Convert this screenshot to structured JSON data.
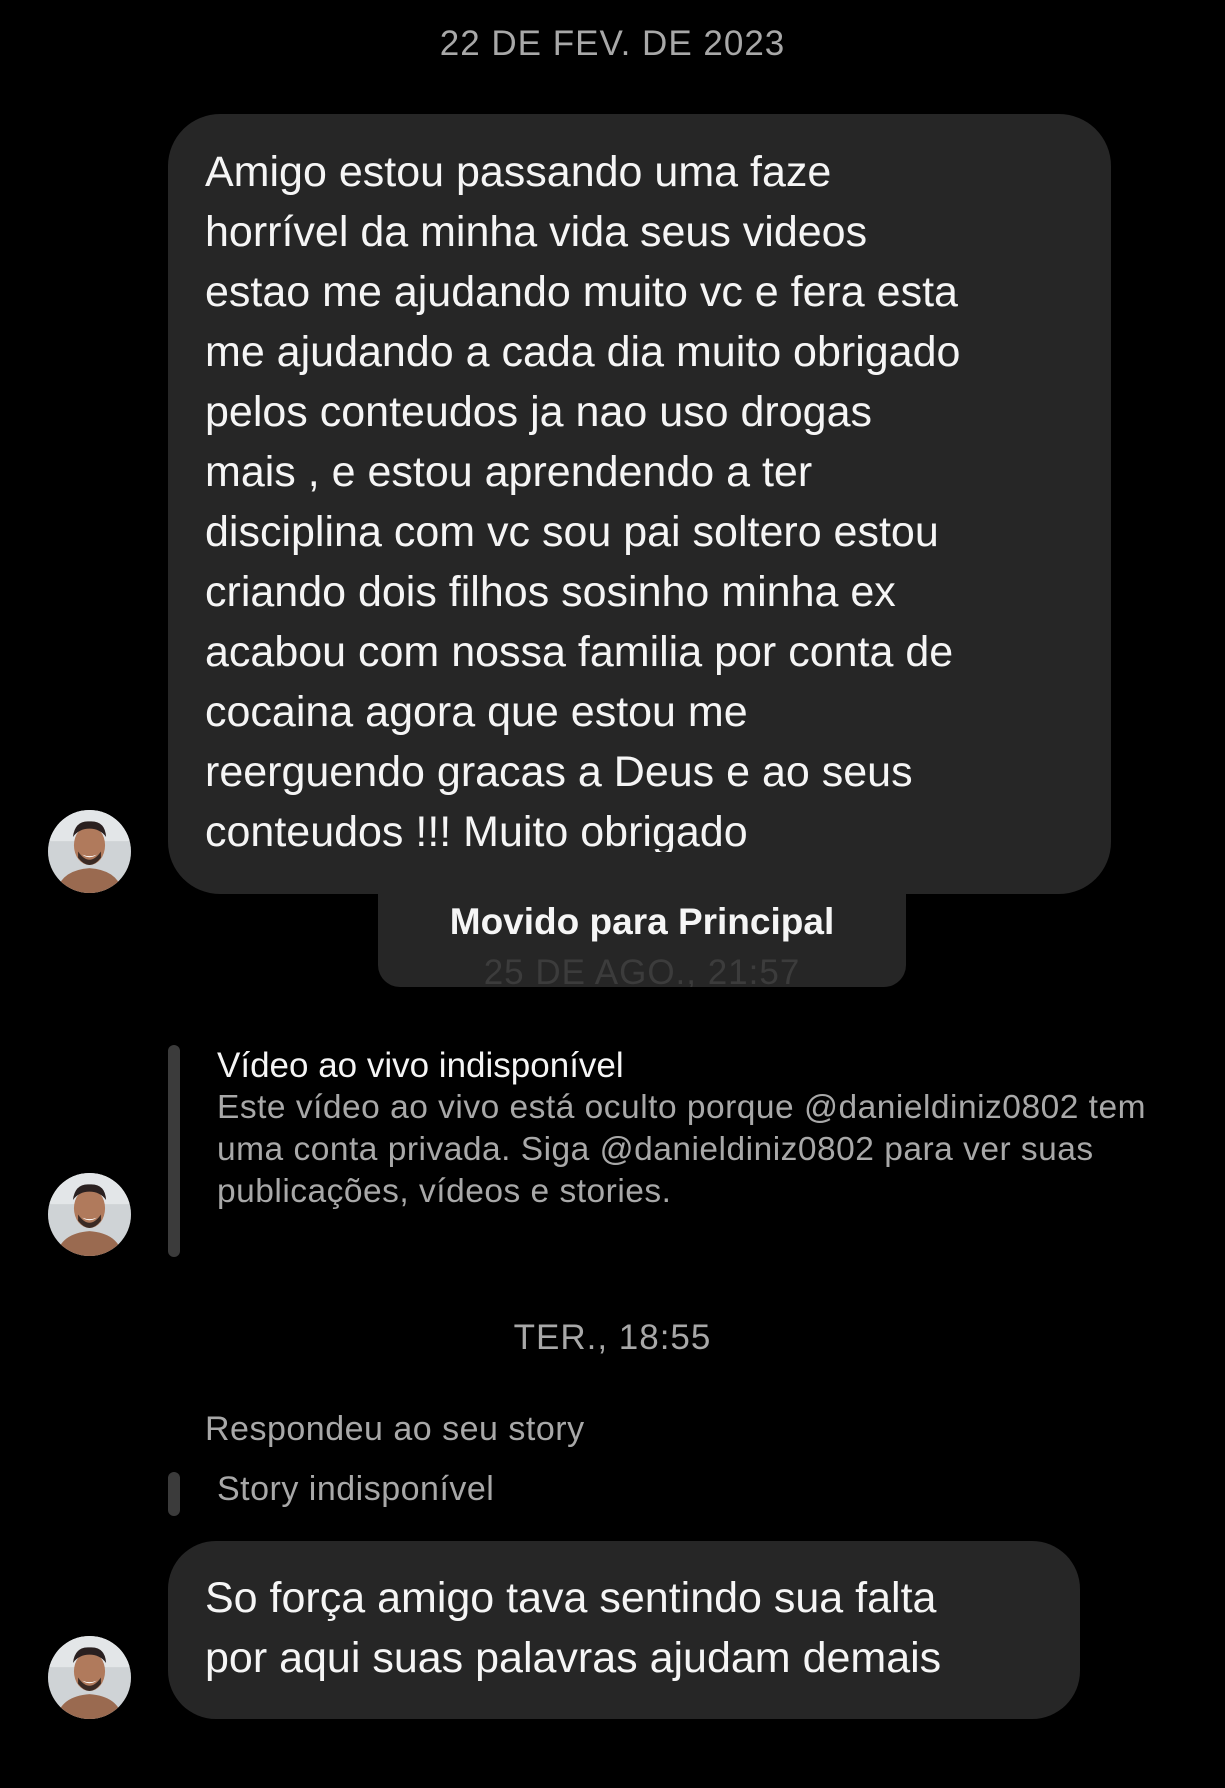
{
  "dates": {
    "first": "22 DE FEV. DE 2023",
    "third": "TER., 18:55"
  },
  "messages": [
    {
      "text": "Amigo estou passando uma faze\nhorrível da minha vida seus videos\nestao me ajudando muito vc e fera esta\nme ajudando a cada dia muito obrigado\npelos conteudos ja nao uso drogas\nmais , e estou aprendendo a ter\ndisciplina com vc sou pai soltero estou\ncriando dois filhos sosinho minha ex\nacabou com nossa familia por conta de\ncocaina agora que estou me\nreerguendo gracas a Deus e ao seus\nconteudos !!! Muito obrigado"
    },
    {
      "text": "So força amigo tava sentindo sua falta\npor aqui  suas palavras ajudam demais"
    }
  ],
  "toast": {
    "title": "Movido para Principal",
    "behind_text": "25 DE AGO., 21:57"
  },
  "live_video": {
    "title": "Vídeo ao vivo indisponível",
    "description": "Este vídeo ao vivo está oculto porque @danieldiniz0802 tem uma conta privada. Siga @danieldiniz0802 para ver suas publicações, vídeos e stories."
  },
  "story_reply": {
    "label": "Respondeu ao seu story",
    "unavailable": "Story indisponível"
  },
  "colors": {
    "background": "#000000",
    "bubble": "#262626",
    "secondary_text": "#a8a8a8",
    "primary_text": "#f5f5f5"
  },
  "icons": {
    "avatar": "profile-photo-avatar"
  }
}
